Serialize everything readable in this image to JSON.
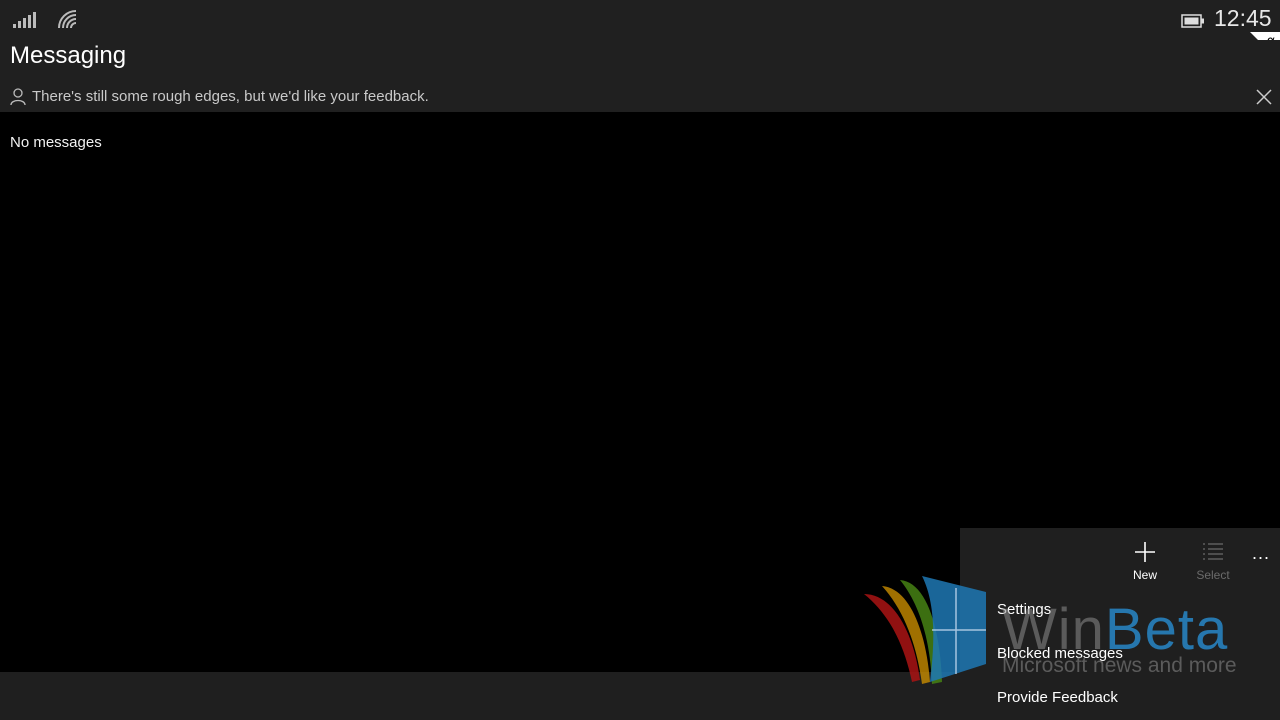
{
  "status_bar": {
    "time": "12:45",
    "alpha_badge": "α",
    "icons": [
      "signal-icon",
      "wifi-icon",
      "battery-icon"
    ]
  },
  "header": {
    "title": "Messaging",
    "feedback_text": "There's still some rough edges, but we'd like your feedback."
  },
  "main": {
    "empty_text": "No messages"
  },
  "app_bar": {
    "new_label": "New",
    "select_label": "Select",
    "more_label": "...",
    "menu": [
      {
        "label": "Settings"
      },
      {
        "label": "Blocked messages"
      },
      {
        "label": "Provide Feedback"
      }
    ]
  },
  "watermark": {
    "win": "Win",
    "beta": "Beta",
    "tagline": "Microsoft news and more"
  },
  "colors": {
    "background": "#000000",
    "chrome": "#202020",
    "app_bar": "#1f1f1f",
    "disabled": "#6b6b6b"
  }
}
